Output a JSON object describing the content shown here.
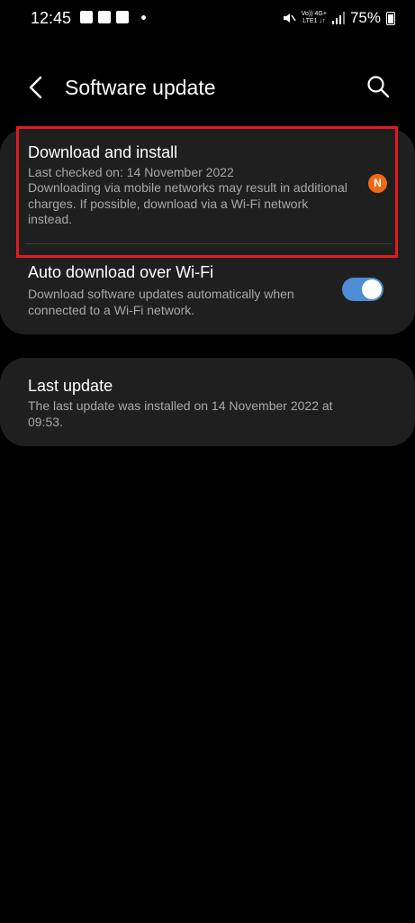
{
  "status": {
    "time": "12:45",
    "network_top": "Vo)) 4G+",
    "network_bottom": "LTE1 ↓↑",
    "battery": "75%"
  },
  "header": {
    "title": "Software update"
  },
  "download": {
    "title": "Download and install",
    "last_checked": "Last checked on: 14 November 2022",
    "description": "Downloading via mobile networks may result in additional charges. If possible, download via a Wi-Fi network instead.",
    "badge": "N"
  },
  "auto_download": {
    "title": "Auto download over Wi-Fi",
    "description": "Download software updates automatically when connected to a Wi-Fi network.",
    "enabled": true
  },
  "last_update": {
    "title": "Last update",
    "description": "The last update was installed on 14 November 2022 at 09:53."
  },
  "colors": {
    "background": "#000000",
    "card": "#1f1f1f",
    "toggle_on": "#4f8cd6",
    "badge": "#f06a16",
    "highlight": "#e11b22"
  }
}
